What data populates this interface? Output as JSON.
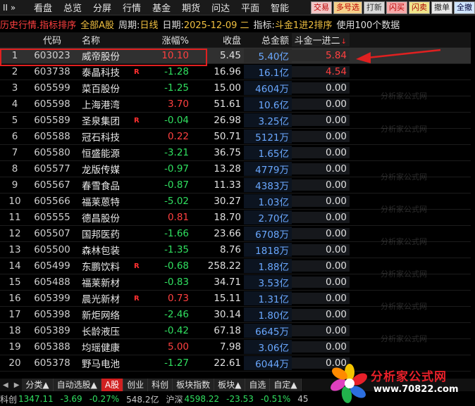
{
  "menubar": {
    "arrows": "II »",
    "items": [
      "看盘",
      "总览",
      "分屏",
      "行情",
      "基金",
      "期货",
      "问达",
      "平面",
      "智能"
    ],
    "quick_buttons": [
      "交易",
      "多号选",
      "打新",
      "闪买",
      "闪卖",
      "撤单",
      "全撤"
    ]
  },
  "titlebar": {
    "view": "历史行情.指标排序",
    "scope": "全部A股",
    "period_label": "周期:",
    "period_value": "日线",
    "date_label": "日期:",
    "date_value": "2025-12-09 二",
    "indicator_label": "指标:",
    "indicator_value": "斗金1进2排序",
    "extra": "使用100个数据"
  },
  "table": {
    "headers": {
      "code": "代码",
      "name": "名称",
      "change": "涨幅%",
      "close": "收盘",
      "amount": "总金额",
      "indicator": "斗金一进二",
      "sort_arrow": "↓"
    },
    "rows": [
      {
        "idx": "1",
        "code": "603023",
        "name": "威帝股份",
        "flag": "",
        "change": "10.10",
        "dir": "up",
        "close": "5.45",
        "amount": "5.40亿",
        "indicator": "5.84",
        "ind_dir": "up"
      },
      {
        "idx": "2",
        "code": "603738",
        "name": "泰晶科技",
        "flag": "R",
        "change": "-1.28",
        "dir": "down",
        "close": "16.96",
        "amount": "16.1亿",
        "indicator": "4.54",
        "ind_dir": "up"
      },
      {
        "idx": "3",
        "code": "605599",
        "name": "菜百股份",
        "flag": "",
        "change": "-1.25",
        "dir": "down",
        "close": "15.00",
        "amount": "4604万",
        "indicator": "0.00",
        "ind_dir": "flat"
      },
      {
        "idx": "4",
        "code": "605598",
        "name": "上海港湾",
        "flag": "",
        "change": "3.70",
        "dir": "up",
        "close": "51.61",
        "amount": "10.6亿",
        "indicator": "0.00",
        "ind_dir": "flat"
      },
      {
        "idx": "5",
        "code": "605589",
        "name": "圣泉集团",
        "flag": "R",
        "change": "-0.04",
        "dir": "down",
        "close": "26.98",
        "amount": "3.25亿",
        "indicator": "0.00",
        "ind_dir": "flat"
      },
      {
        "idx": "6",
        "code": "605588",
        "name": "冠石科技",
        "flag": "",
        "change": "0.22",
        "dir": "up",
        "close": "50.71",
        "amount": "5121万",
        "indicator": "0.00",
        "ind_dir": "flat"
      },
      {
        "idx": "7",
        "code": "605580",
        "name": "恒盛能源",
        "flag": "",
        "change": "-3.21",
        "dir": "down",
        "close": "36.75",
        "amount": "1.65亿",
        "indicator": "0.00",
        "ind_dir": "flat"
      },
      {
        "idx": "8",
        "code": "605577",
        "name": "龙版传媒",
        "flag": "",
        "change": "-0.97",
        "dir": "down",
        "close": "13.28",
        "amount": "4779万",
        "indicator": "0.00",
        "ind_dir": "flat"
      },
      {
        "idx": "9",
        "code": "605567",
        "name": "春雪食品",
        "flag": "",
        "change": "-0.87",
        "dir": "down",
        "close": "11.33",
        "amount": "4383万",
        "indicator": "0.00",
        "ind_dir": "flat"
      },
      {
        "idx": "10",
        "code": "605566",
        "name": "福莱蒽特",
        "flag": "",
        "change": "-5.02",
        "dir": "down",
        "close": "30.27",
        "amount": "1.03亿",
        "indicator": "0.00",
        "ind_dir": "flat"
      },
      {
        "idx": "11",
        "code": "605555",
        "name": "德昌股份",
        "flag": "",
        "change": "0.81",
        "dir": "up",
        "close": "18.70",
        "amount": "2.70亿",
        "indicator": "0.00",
        "ind_dir": "flat"
      },
      {
        "idx": "12",
        "code": "605507",
        "name": "国邦医药",
        "flag": "",
        "change": "-1.66",
        "dir": "down",
        "close": "23.66",
        "amount": "6708万",
        "indicator": "0.00",
        "ind_dir": "flat"
      },
      {
        "idx": "13",
        "code": "605500",
        "name": "森林包装",
        "flag": "",
        "change": "-1.35",
        "dir": "down",
        "close": "8.76",
        "amount": "1818万",
        "indicator": "0.00",
        "ind_dir": "flat"
      },
      {
        "idx": "14",
        "code": "605499",
        "name": "东鹏饮料",
        "flag": "R",
        "change": "-0.68",
        "dir": "down",
        "close": "258.22",
        "amount": "1.88亿",
        "indicator": "0.00",
        "ind_dir": "flat"
      },
      {
        "idx": "15",
        "code": "605488",
        "name": "福莱新材",
        "flag": "",
        "change": "-0.83",
        "dir": "down",
        "close": "34.71",
        "amount": "3.53亿",
        "indicator": "0.00",
        "ind_dir": "flat"
      },
      {
        "idx": "16",
        "code": "605399",
        "name": "晨光新材",
        "flag": "R",
        "change": "0.73",
        "dir": "up",
        "close": "15.11",
        "amount": "1.31亿",
        "indicator": "0.00",
        "ind_dir": "flat"
      },
      {
        "idx": "17",
        "code": "605398",
        "name": "新炬网络",
        "flag": "",
        "change": "-2.46",
        "dir": "down",
        "close": "30.14",
        "amount": "1.80亿",
        "indicator": "0.00",
        "ind_dir": "flat"
      },
      {
        "idx": "18",
        "code": "605389",
        "name": "长龄液压",
        "flag": "",
        "change": "-0.42",
        "dir": "down",
        "close": "67.18",
        "amount": "6645万",
        "indicator": "0.00",
        "ind_dir": "flat"
      },
      {
        "idx": "19",
        "code": "605388",
        "name": "均瑶健康",
        "flag": "",
        "change": "5.00",
        "dir": "up",
        "close": "7.98",
        "amount": "3.06亿",
        "indicator": "0.00",
        "ind_dir": "flat"
      },
      {
        "idx": "20",
        "code": "605378",
        "name": "野马电池",
        "flag": "",
        "change": "-1.27",
        "dir": "down",
        "close": "22.61",
        "amount": "6044万",
        "indicator": "0.00",
        "ind_dir": "flat"
      }
    ]
  },
  "watermark": "分析家公式网",
  "tabs": [
    "分类▲",
    "自动选股▲",
    "A股",
    "创业",
    "科创",
    "板块指数",
    "板块▲",
    "自选",
    "自定▲"
  ],
  "active_tab": "A股",
  "statusbar": {
    "idx1_name": "科创",
    "idx1_value": "1347.11",
    "idx1_change": "-3.69",
    "idx1_pct": "-0.27%",
    "idx1_amount": "548.2亿",
    "idx2_name": "沪深",
    "idx2_value": "4598.22",
    "idx2_change": "-23.53",
    "idx2_pct": "-0.51%",
    "idx2_amount": "45"
  },
  "logo": {
    "text": "分析家公式网",
    "url": "www.70822.com"
  },
  "colors": {
    "up": "#ff4040",
    "down": "#30e060",
    "amount": "#6aa8ff",
    "annotation": "#e02020"
  }
}
